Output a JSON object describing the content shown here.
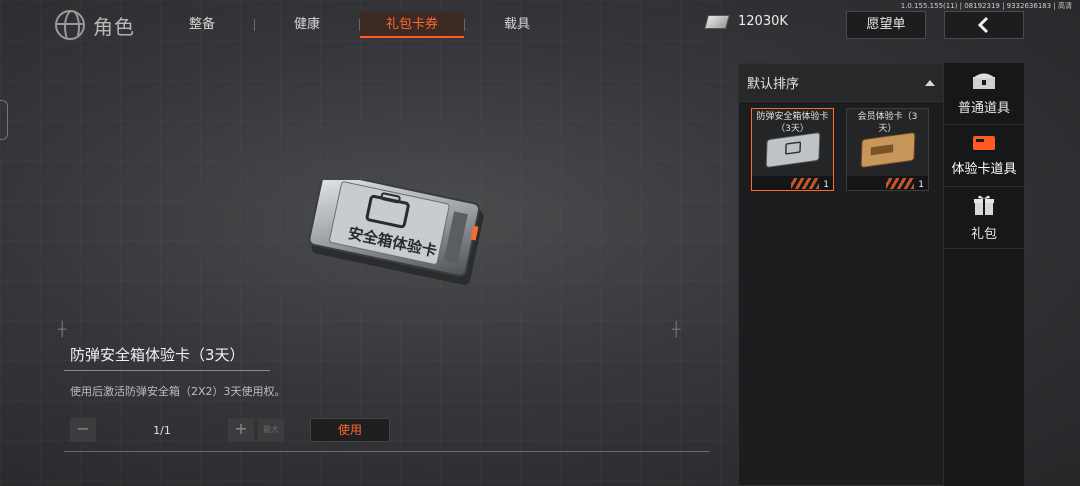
{
  "build_info": "1.0.155.155(11) | 08192319 | 9332636183 | 高清",
  "header": {
    "logo_text": "角色",
    "tabs": [
      {
        "label": "整备",
        "active": false
      },
      {
        "label": "健康",
        "active": false
      },
      {
        "label": "礼包卡券",
        "active": true
      },
      {
        "label": "载具",
        "active": false
      }
    ],
    "currency_value": "12030K",
    "wishlist_label": "愿望单",
    "back_icon": "back-chevron-icon"
  },
  "item": {
    "title": "防弹安全箱体验卡（3天）",
    "card_text": "安全箱体验卡",
    "description": "使用后激活防弹安全箱（2X2）3天使用权。",
    "quantity": "1/1",
    "minus": "−",
    "plus": "+",
    "max": "最大",
    "use_label": "使用"
  },
  "inventory": {
    "sort_label": "默认排序",
    "slots": [
      {
        "name": "防弹安全箱体验卡（3天）",
        "count": "1",
        "selected": true,
        "color": "#bfc3c6"
      },
      {
        "name": "会员体验卡（3天）",
        "count": "1",
        "selected": false,
        "color": "#c8955a"
      }
    ]
  },
  "categories": [
    {
      "label": "普通道具",
      "icon": "chest-icon",
      "active": false
    },
    {
      "label": "体验卡道具",
      "icon": "card-icon",
      "active": true
    },
    {
      "label": "礼包",
      "icon": "gift-icon",
      "active": false
    }
  ],
  "colors": {
    "accent": "#ff6a2c"
  }
}
